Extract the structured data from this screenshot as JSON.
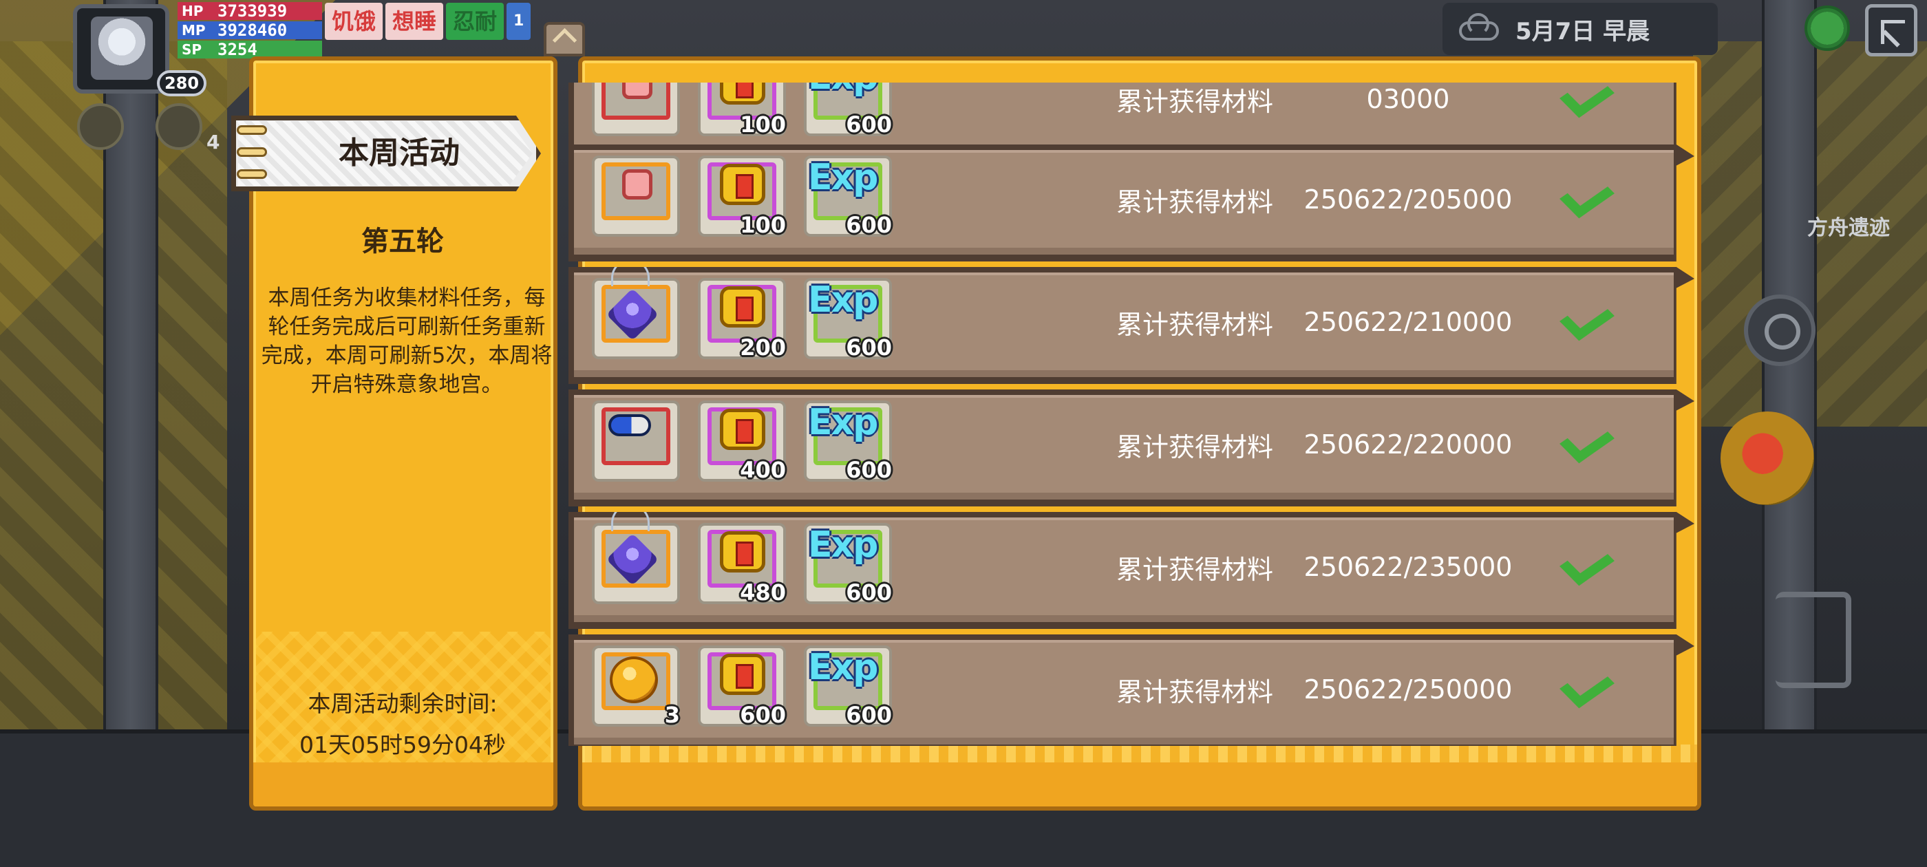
{
  "hud": {
    "level": "280",
    "stats": [
      {
        "label": "HP",
        "value": "3733939"
      },
      {
        "label": "MP",
        "value": "3928460"
      },
      {
        "label": "SP",
        "value": "3254"
      }
    ],
    "badges": [
      "饥饿",
      "想睡",
      "忍耐"
    ],
    "badge_extra": "1",
    "side_count": "4",
    "date": "5月7日  早晨",
    "location": "方舟遗迹",
    "icons": [
      "avatar",
      "cloud-icon",
      "globe-icon",
      "expand-icon",
      "search-icon",
      "bomb-icon",
      "bow-icon"
    ]
  },
  "left_panel": {
    "tab_title": "本周活动",
    "round": "第五轮",
    "description": "本周任务为收集材料任务，每轮任务完成后可刷新任务重新完成，本周可刷新5次，本周将开启特殊意象地宫。",
    "remaining_label": "本周活动剩余时间:",
    "remaining_time": "01天05时59分04秒"
  },
  "tasks": [
    {
      "items": [
        {
          "icon": "ticket-icon",
          "frame": "red",
          "qty": ""
        },
        {
          "icon": "gift-icon",
          "frame": "purple",
          "qty": "100"
        },
        {
          "icon": "exp-icon",
          "frame": "green",
          "qty": "600"
        }
      ],
      "text": "累计获得材料",
      "goal_line1": "",
      "goal_line2": "03000",
      "done": true
    },
    {
      "items": [
        {
          "icon": "ticket-icon",
          "frame": "orange",
          "qty": ""
        },
        {
          "icon": "gift-icon",
          "frame": "purple",
          "qty": "100"
        },
        {
          "icon": "exp-icon",
          "frame": "green",
          "qty": "600"
        }
      ],
      "text": "累计获得材料",
      "goal_line1": "250622/2",
      "goal_line2": "05000",
      "done": true
    },
    {
      "items": [
        {
          "icon": "gem-icon",
          "frame": "orange",
          "qty": ""
        },
        {
          "icon": "gift-icon",
          "frame": "purple",
          "qty": "200"
        },
        {
          "icon": "exp-icon",
          "frame": "green",
          "qty": "600"
        }
      ],
      "text": "累计获得材料",
      "goal_line1": "250622/2",
      "goal_line2": "10000",
      "done": true
    },
    {
      "items": [
        {
          "icon": "pill-icon",
          "frame": "red",
          "qty": ""
        },
        {
          "icon": "gift-icon",
          "frame": "purple",
          "qty": "400"
        },
        {
          "icon": "exp-icon",
          "frame": "green",
          "qty": "600"
        }
      ],
      "text": "累计获得材料",
      "goal_line1": "250622/2",
      "goal_line2": "20000",
      "done": true
    },
    {
      "items": [
        {
          "icon": "gem-icon",
          "frame": "orange",
          "qty": ""
        },
        {
          "icon": "gift-icon",
          "frame": "purple",
          "qty": "480"
        },
        {
          "icon": "exp-icon",
          "frame": "green",
          "qty": "600"
        }
      ],
      "text": "累计获得材料",
      "goal_line1": "250622/2",
      "goal_line2": "35000",
      "done": true
    },
    {
      "items": [
        {
          "icon": "apple-icon",
          "frame": "orange",
          "qty": "3"
        },
        {
          "icon": "gift-icon",
          "frame": "purple",
          "qty": "600"
        },
        {
          "icon": "exp-icon",
          "frame": "green",
          "qty": "600"
        }
      ],
      "text": "累计获得材料",
      "goal_line1": "250622/2",
      "goal_line2": "50000",
      "done": true
    }
  ],
  "exp_label": "Exp",
  "colors": {
    "panel": "#f6b624",
    "panel_border": "#a86a12",
    "row": "#a48a76",
    "check": "#3fb03a"
  }
}
